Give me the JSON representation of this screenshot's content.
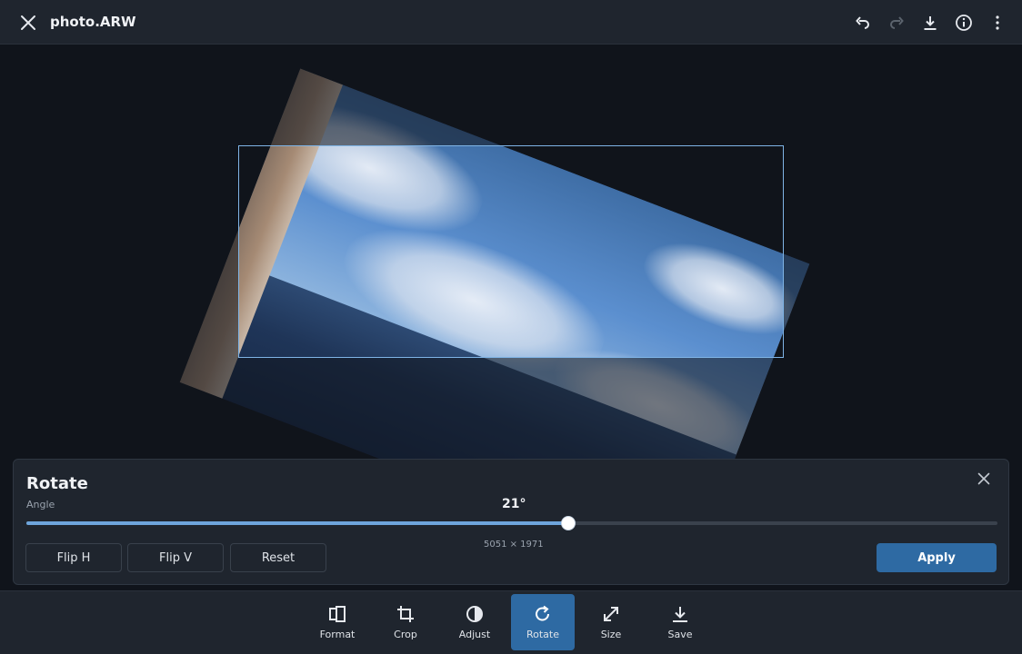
{
  "header": {
    "title": "photo.ARW",
    "icons": [
      "close-icon",
      "undo-icon",
      "redo-icon",
      "download-icon",
      "info-icon",
      "more-vertical-icon"
    ]
  },
  "rotate_panel": {
    "title": "Rotate",
    "angle_label": "Angle",
    "angle_value": "21°",
    "slider_fraction": 0.558,
    "dimensions": "5051 × 1971",
    "buttons": {
      "flip_h": "Flip H",
      "flip_v": "Flip V",
      "reset": "Reset",
      "apply": "Apply"
    }
  },
  "toolbar": {
    "active": "Rotate",
    "items": [
      {
        "label": "Format",
        "icon": "format-icon"
      },
      {
        "label": "Crop",
        "icon": "crop-icon"
      },
      {
        "label": "Adjust",
        "icon": "adjust-icon"
      },
      {
        "label": "Rotate",
        "icon": "rotate-icon"
      },
      {
        "label": "Size",
        "icon": "resize-icon"
      },
      {
        "label": "Save",
        "icon": "save-icon"
      }
    ]
  },
  "colors": {
    "accent": "#2e6aa3",
    "slider_fill": "#6ea5dc",
    "panel_bg": "#1f252e",
    "canvas_bg": "#10141b"
  }
}
